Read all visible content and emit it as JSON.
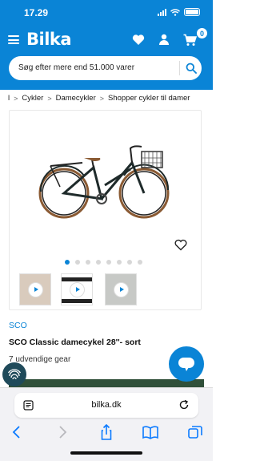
{
  "status_bar": {
    "time": "17.29"
  },
  "header": {
    "logo": "Bilka",
    "cart_count": "0",
    "search": {
      "placeholder": "Søg efter mere end 51.000 varer"
    }
  },
  "breadcrumbs": [
    {
      "label": "l"
    },
    {
      "label": "Cykler"
    },
    {
      "label": "Damecykler"
    },
    {
      "label": "Shopper cykler til damer"
    }
  ],
  "gallery": {
    "dot_count": 8,
    "active_dot": 0,
    "thumbnails": [
      "video-thumb-1",
      "video-thumb-2",
      "video-thumb-3"
    ]
  },
  "product": {
    "brand": "SCO",
    "title": "SCO Classic damecykel 28''- sort",
    "description": "7 udvendige gear"
  },
  "browser": {
    "url": "bilka.dk"
  },
  "colors": {
    "brand_blue": "#0a84d6",
    "frame": "#1e2a2a"
  }
}
